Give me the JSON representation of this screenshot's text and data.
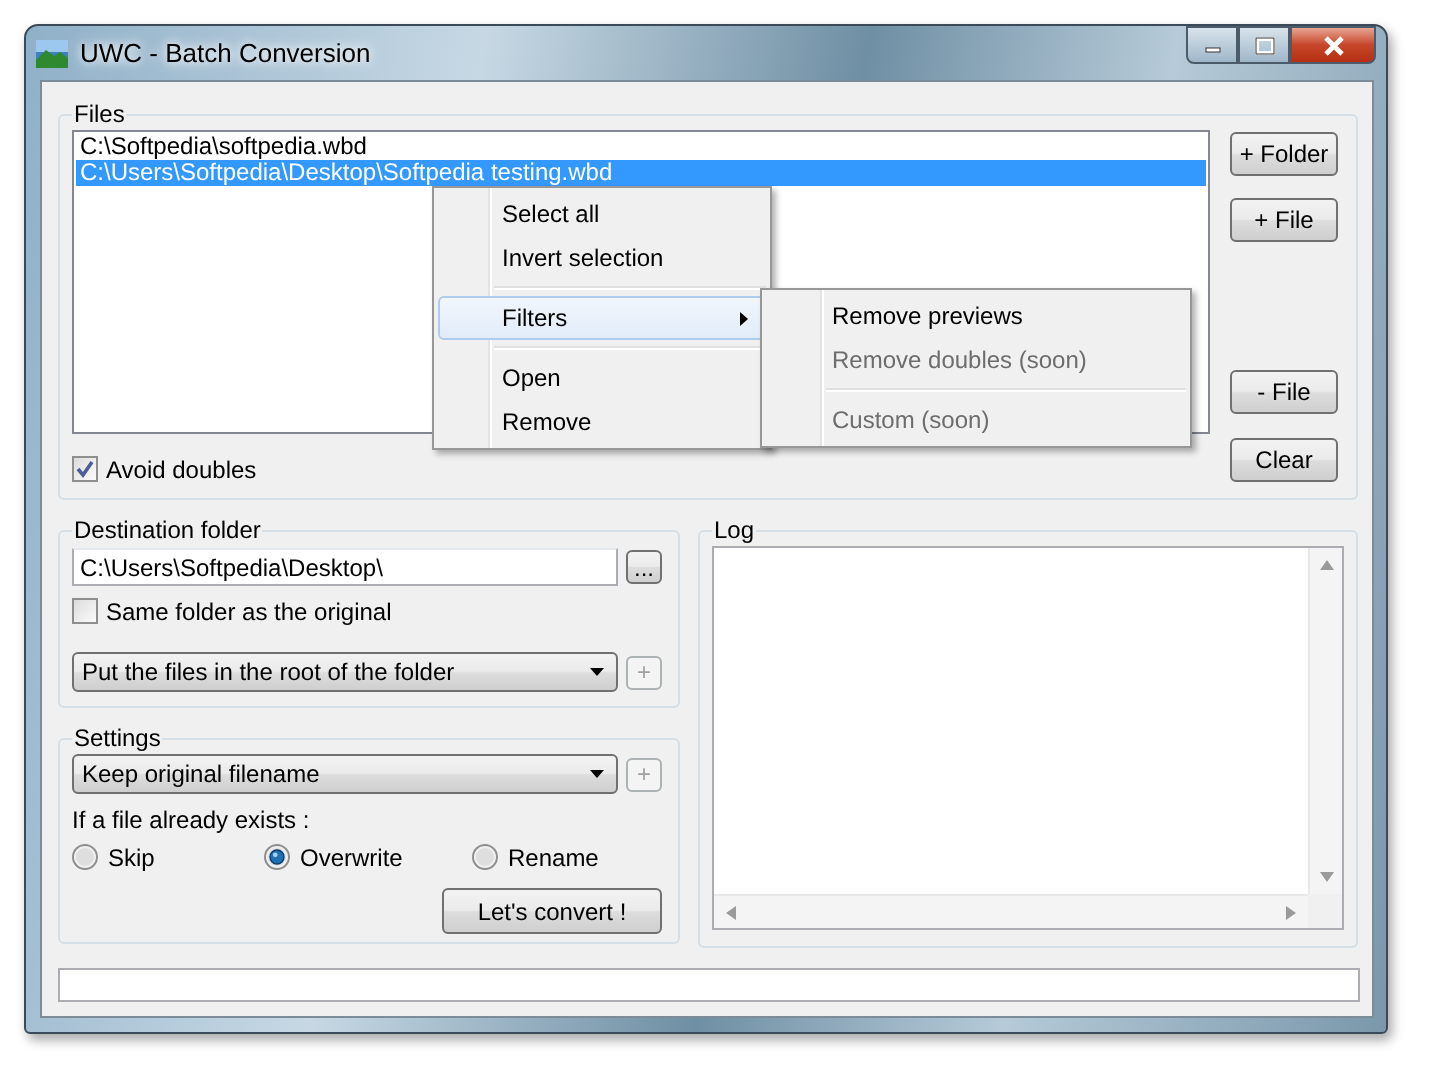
{
  "window": {
    "title": "UWC - Batch Conversion"
  },
  "files": {
    "label": "Files",
    "items": [
      {
        "path": "C:\\Softpedia\\softpedia.wbd",
        "selected": false
      },
      {
        "path": "C:\\Users\\Softpedia\\Desktop\\Softpedia testing.wbd",
        "selected": true
      }
    ],
    "buttons": [
      "+ Folder",
      "+ File",
      "- File",
      "Clear"
    ],
    "avoid_doubles": {
      "label": "Avoid doubles",
      "checked": true
    }
  },
  "context_menu": {
    "groups": [
      [
        {
          "kind": "item",
          "label": "Select all",
          "selected": false
        },
        {
          "kind": "item",
          "label": "Invert selection",
          "selected": false
        }
      ],
      [
        {
          "kind": "submenu",
          "label": "Filters",
          "selected": true
        }
      ],
      [
        {
          "kind": "item",
          "label": "Open",
          "selected": false
        },
        {
          "kind": "item",
          "label": "Remove",
          "selected": false
        }
      ]
    ]
  },
  "filters_menu": {
    "groups": [
      [
        {
          "label": "Remove previews",
          "disabled": false
        },
        {
          "label": "Remove doubles (soon)",
          "disabled": true
        }
      ],
      [
        {
          "label": "Custom (soon)",
          "disabled": true
        }
      ]
    ]
  },
  "destination": {
    "label": "Destination folder",
    "path": "C:\\Users\\Softpedia\\Desktop\\",
    "browse": "...",
    "same_folder": {
      "label": "Same folder as the original",
      "checked": false
    },
    "structure": {
      "value": "Put the files in the root of the folder",
      "add": "+",
      "add_disabled": true
    }
  },
  "settings": {
    "label": "Settings",
    "naming": {
      "value": "Keep original filename",
      "add": "+",
      "add_disabled": true
    },
    "exists_label": "If a file already exists :",
    "options": [
      {
        "label": "Skip",
        "selected": false
      },
      {
        "label": "Overwrite",
        "selected": true
      },
      {
        "label": "Rename",
        "selected": false
      }
    ],
    "convert": "Let's convert !"
  },
  "log": {
    "label": "Log"
  }
}
